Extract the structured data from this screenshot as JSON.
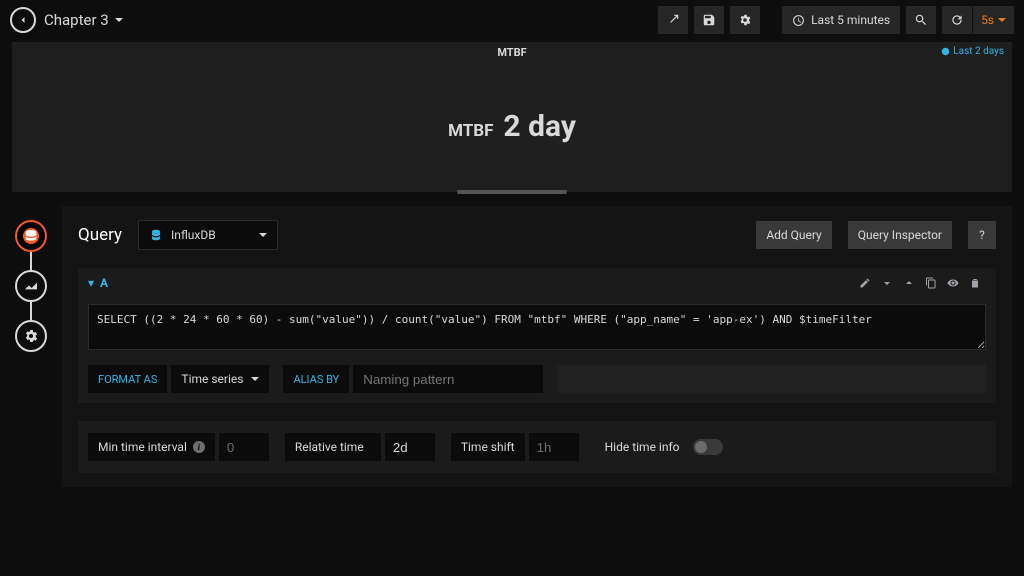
{
  "header": {
    "title": "Chapter 3",
    "time_range": "Last 5 minutes",
    "refresh_rate": "5s"
  },
  "panel": {
    "title": "MTBF",
    "corner_link": "Last 2 days",
    "stat_label": "MTBF",
    "stat_value": "2 day"
  },
  "editor": {
    "tab_label": "Query",
    "datasource": "InfluxDB",
    "add_query_btn": "Add Query",
    "query_inspector_btn": "Query Inspector",
    "help_btn": "?"
  },
  "query": {
    "letter": "A",
    "sql": "SELECT ((2 * 24 * 60 * 60) - sum(\"value\")) / count(\"value\") FROM \"mtbf\" WHERE (\"app_name\" = 'app-ex') AND $timeFilter",
    "format_as_label": "FORMAT AS",
    "format_as_value": "Time series",
    "alias_by_label": "ALIAS BY",
    "alias_by_placeholder": "Naming pattern"
  },
  "options": {
    "min_interval_label": "Min time interval",
    "min_interval_placeholder": "0",
    "relative_time_label": "Relative time",
    "relative_time_value": "2d",
    "time_shift_label": "Time shift",
    "time_shift_placeholder": "1h",
    "hide_time_label": "Hide time info"
  }
}
